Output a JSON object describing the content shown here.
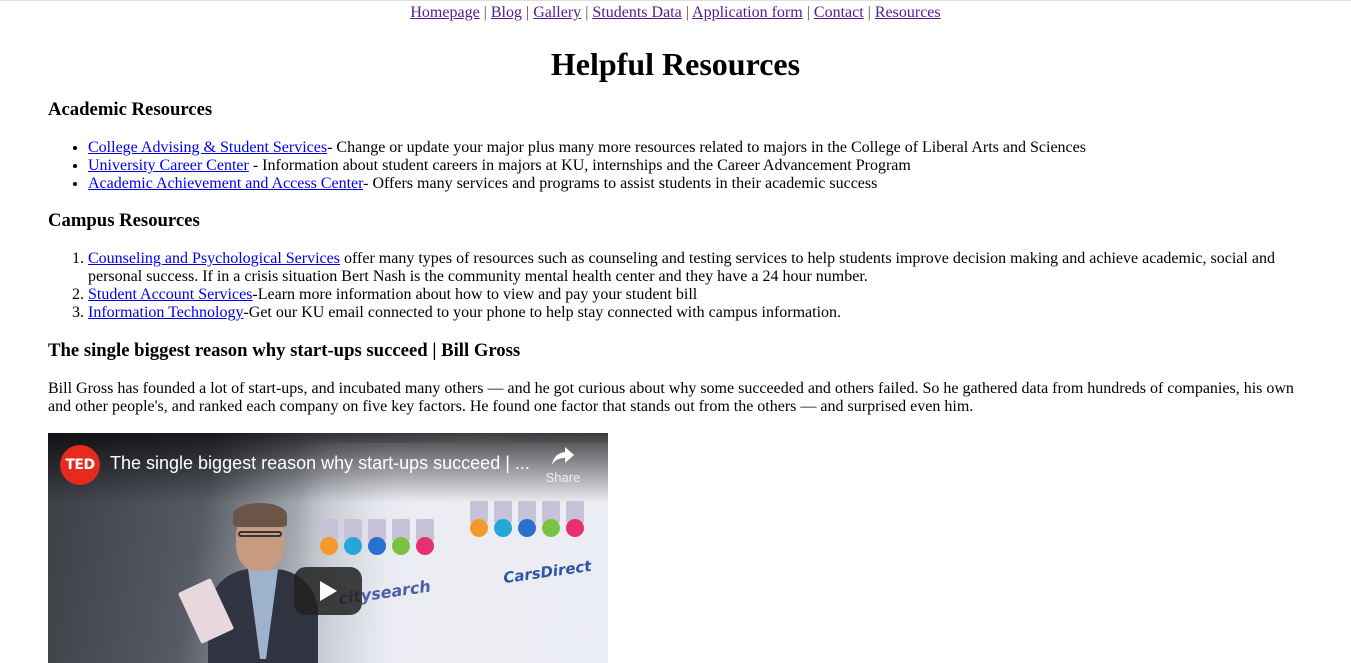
{
  "nav": {
    "items": [
      "Homepage",
      "Blog",
      "Gallery",
      "Students Data",
      "Application form",
      "Contact",
      "Resources"
    ],
    "separator": "|"
  },
  "page_title": "Helpful Resources",
  "academic": {
    "heading": "Academic Resources",
    "items": [
      {
        "link": "College Advising & Student Services",
        "text": "- Change or update your major plus many more resources related to majors in the College of Liberal Arts and Sciences"
      },
      {
        "link": "University Career Center",
        "text": " - Information about student careers in majors at KU, internships and the Career Advancement Program"
      },
      {
        "link": "Academic Achievement and Access Center",
        "text": "- Offers many services and programs to assist students in their academic success"
      }
    ]
  },
  "campus": {
    "heading": "Campus Resources",
    "items": [
      {
        "link": "Counseling and Psychological Services",
        "text": " offer many types of resources such as counseling and testing services to help students improve decision making and achieve academic, social and personal success. If in a crisis situation Bert Nash is the community mental health center and they have a 24 hour number."
      },
      {
        "link": "Student Account Services",
        "text": "-Learn more information about how to view and pay your student bill"
      },
      {
        "link": "Information Technology",
        "text": "-Get our KU email connected to your phone to help stay connected with campus information."
      }
    ]
  },
  "talk": {
    "heading": "The single biggest reason why start-ups succeed | Bill Gross",
    "description": "Bill Gross has founded a lot of start-ups, and incubated many others — and he got curious about why some succeeded and others failed. So he gathered data from hundreds of companies, his own and other people's, and ranked each company on five key factors. He found one factor that stands out from the others — and surprised even him.",
    "video": {
      "logo": "TED",
      "title": "The single biggest reason why start-ups succeed | ...",
      "share_label": "Share",
      "slide_brand_1": "citysearch",
      "slide_brand_2": "CarsDirect"
    }
  },
  "colors": {
    "visited_link": "#551a8b",
    "link": "#0000ee",
    "ted_red": "#e62b1e"
  },
  "icons": [
    "share-icon",
    "play-icon"
  ]
}
